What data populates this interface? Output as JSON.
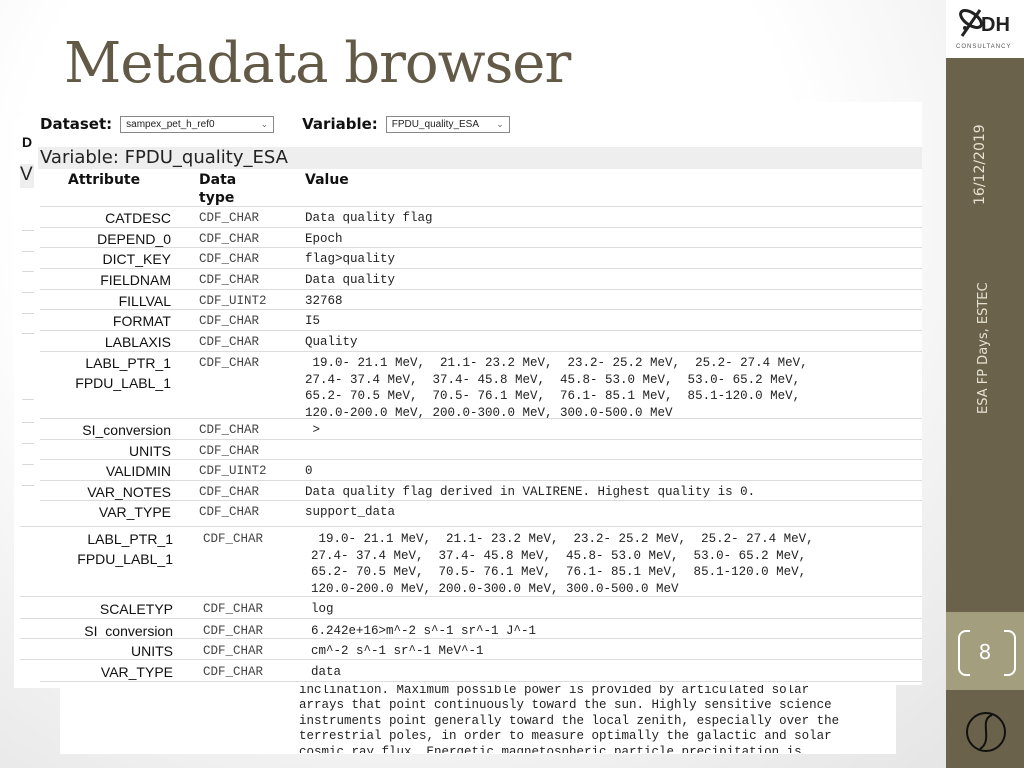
{
  "slide": {
    "title": "Metadata browser",
    "date": "16/12/2019",
    "event": "ESA FP Days, ESTEC",
    "page_number": "8",
    "logo": {
      "text": "DH",
      "subtitle": "CONSULTANCY"
    }
  },
  "controls": {
    "dataset_label": "Dataset:",
    "dataset_value": "sampex_pet_h_ref0",
    "variable_label": "Variable:",
    "variable_value": "FPDU_quality_ESA"
  },
  "heading": "Variable: FPDU_quality_ESA",
  "columns": {
    "attribute": "Attribute",
    "data_type_1": "Data",
    "data_type_2": "type",
    "value": "Value"
  },
  "rows": [
    {
      "attr": "CATDESC",
      "dtype": "CDF_CHAR",
      "value": "Data quality flag"
    },
    {
      "attr": "DEPEND_0",
      "dtype": "CDF_CHAR",
      "value": "Epoch"
    },
    {
      "attr": "DICT_KEY",
      "dtype": "CDF_CHAR",
      "value": "flag>quality"
    },
    {
      "attr": "FIELDNAM",
      "dtype": "CDF_CHAR",
      "value": "Data quality"
    },
    {
      "attr": "FILLVAL",
      "dtype": "CDF_UINT2",
      "value": "32768"
    },
    {
      "attr": "FORMAT",
      "dtype": "CDF_CHAR",
      "value": "I5"
    },
    {
      "attr": "LABLAXIS",
      "dtype": "CDF_CHAR",
      "value": "Quality"
    },
    {
      "attr": "LABL_PTR_1\nFPDU_LABL_1",
      "dtype": "CDF_CHAR",
      "value": " 19.0- 21.1 MeV,  21.1- 23.2 MeV,  23.2- 25.2 MeV,  25.2- 27.4 MeV,\n27.4- 37.4 MeV,  37.4- 45.8 MeV,  45.8- 53.0 MeV,  53.0- 65.2 MeV,\n65.2- 70.5 MeV,  70.5- 76.1 MeV,  76.1- 85.1 MeV,  85.1-120.0 MeV,\n120.0-200.0 MeV, 200.0-300.0 MeV, 300.0-500.0 MeV"
    },
    {
      "attr": "SI_conversion",
      "dtype": "CDF_CHAR",
      "value": " >"
    },
    {
      "attr": "UNITS",
      "dtype": "CDF_CHAR",
      "value": ""
    },
    {
      "attr": "VALIDMIN",
      "dtype": "CDF_UINT2",
      "value": "0"
    },
    {
      "attr": "VAR_NOTES",
      "dtype": "CDF_CHAR",
      "value": "Data quality flag derived in VALIRENE. Highest quality is 0."
    },
    {
      "attr": "VAR_TYPE",
      "dtype": "CDF_CHAR",
      "value": "support_data"
    }
  ],
  "rows2": [
    {
      "attr": "LABL_PTR_1\nFPDU_LABL_1",
      "dtype": "CDF_CHAR",
      "value": " 19.0- 21.1 MeV,  21.1- 23.2 MeV,  23.2- 25.2 MeV,  25.2- 27.4 MeV,\n27.4- 37.4 MeV,  37.4- 45.8 MeV,  45.8- 53.0 MeV,  53.0- 65.2 MeV,\n65.2- 70.5 MeV,  70.5- 76.1 MeV,  76.1- 85.1 MeV,  85.1-120.0 MeV,\n120.0-200.0 MeV, 200.0-300.0 MeV, 300.0-500.0 MeV"
    },
    {
      "attr": "SCALETYP",
      "dtype": "CDF_CHAR",
      "value": "log"
    },
    {
      "attr": "SI_conversion",
      "dtype": "CDF_CHAR",
      "value": "6.242e+16>m^-2 s^-1 sr^-1 J^-1"
    },
    {
      "attr": "UNITS",
      "dtype": "CDF_CHAR",
      "value": "cm^-2 s^-1 sr^-1 MeV^-1"
    },
    {
      "attr": "VAR_TYPE",
      "dtype": "CDF_CHAR",
      "value": "data"
    }
  ],
  "background_window": {
    "label_d": "D",
    "label_v": "V",
    "description": "inclination. Maximum possible power is provided by articulated solar\narrays that point continuously toward the sun. Highly sensitive science\ninstruments point generally toward the local zenith, especially over the\nterrestrial poles, in order to measure optimally the galactic and solar\ncosmic ray flux. Energetic magnetospheric particle precipitation is"
  },
  "icons": {
    "logo": "dh-consultancy-logo-icon",
    "select_chevron": "chevron-down-icon",
    "bottom_mark": "circle-s-logo-icon"
  }
}
